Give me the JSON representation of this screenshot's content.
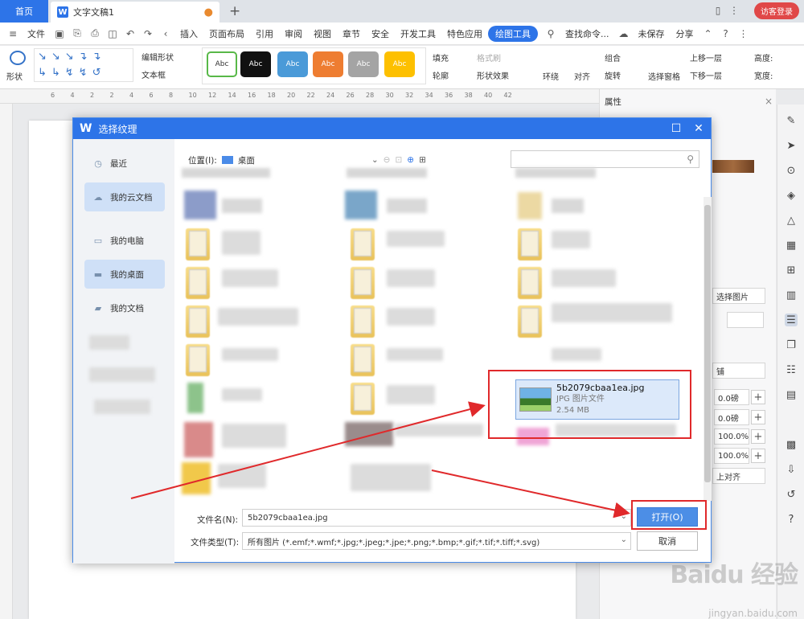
{
  "titlebar": {
    "home_tab": "首页",
    "doc_tab": "文字文稿1",
    "doc_icon": "W",
    "visitor_login": "访客登录"
  },
  "menubar": {
    "file": "文件",
    "items": [
      "插入",
      "页面布局",
      "引用",
      "审阅",
      "视图",
      "章节",
      "安全",
      "开发工具",
      "特色应用"
    ],
    "active": "绘图工具",
    "search": "查找命令...",
    "unsaved": "未保存",
    "share": "分享"
  },
  "ribbon": {
    "shape": "形状",
    "edit_shape": "编辑形状",
    "textbox": "文本框",
    "style_label": "Abc",
    "fill": "填充",
    "outline": "轮廓",
    "format_brush": "格式刷",
    "shape_effect": "形状效果",
    "wrap": "环绕",
    "align": "对齐",
    "group": "组合",
    "rotate": "旋转",
    "select_pane": "选择窗格",
    "bring_forward": "上移一层",
    "send_backward": "下移一层",
    "height": "高度:",
    "width": "宽度:"
  },
  "ruler": {
    "ticks": [
      "6",
      "4",
      "2",
      "2",
      "4",
      "6",
      "8",
      "10",
      "12",
      "14",
      "16",
      "18",
      "20",
      "22",
      "24",
      "26",
      "28",
      "30",
      "32",
      "34",
      "36",
      "38",
      "40",
      "42"
    ]
  },
  "props": {
    "title": "属性",
    "select_pic": "选择图片",
    "offset_x": "0.0磅",
    "offset_y": "0.0磅",
    "scale_x": "100.0%",
    "scale_y": "100.0%",
    "align": "上对齐",
    "spread": "铺"
  },
  "dialog": {
    "title": "选择纹理",
    "location_label": "位置(I):",
    "location_value": "桌面",
    "sidebar": [
      {
        "label": "最近",
        "icon": "clock-icon"
      },
      {
        "label": "我的云文档",
        "icon": "cloud-icon"
      },
      {
        "label": "我的电脑",
        "icon": "computer-icon"
      },
      {
        "label": "我的桌面",
        "icon": "desktop-icon"
      },
      {
        "label": "我的文档",
        "icon": "folder-icon"
      }
    ],
    "selected_file": {
      "name": "5b2079cbaa1ea.jpg",
      "type": "JPG 图片文件",
      "size": "2.54 MB"
    },
    "filename_label": "文件名(N):",
    "filename_value": "5b2079cbaa1ea.jpg",
    "filetype_label": "文件类型(T):",
    "filetype_value": "所有图片 (*.emf;*.wmf;*.jpg;*.jpeg;*.jpe;*.png;*.bmp;*.gif;*.tif;*.tiff;*.svg)",
    "open_button": "打开(O)",
    "cancel_button": "取消"
  },
  "watermark": {
    "brand": "Baidu 经验",
    "url": "jingyan.baidu.com"
  },
  "colors": {
    "accent": "#2d74e8",
    "annotation_red": "#e0292b"
  }
}
